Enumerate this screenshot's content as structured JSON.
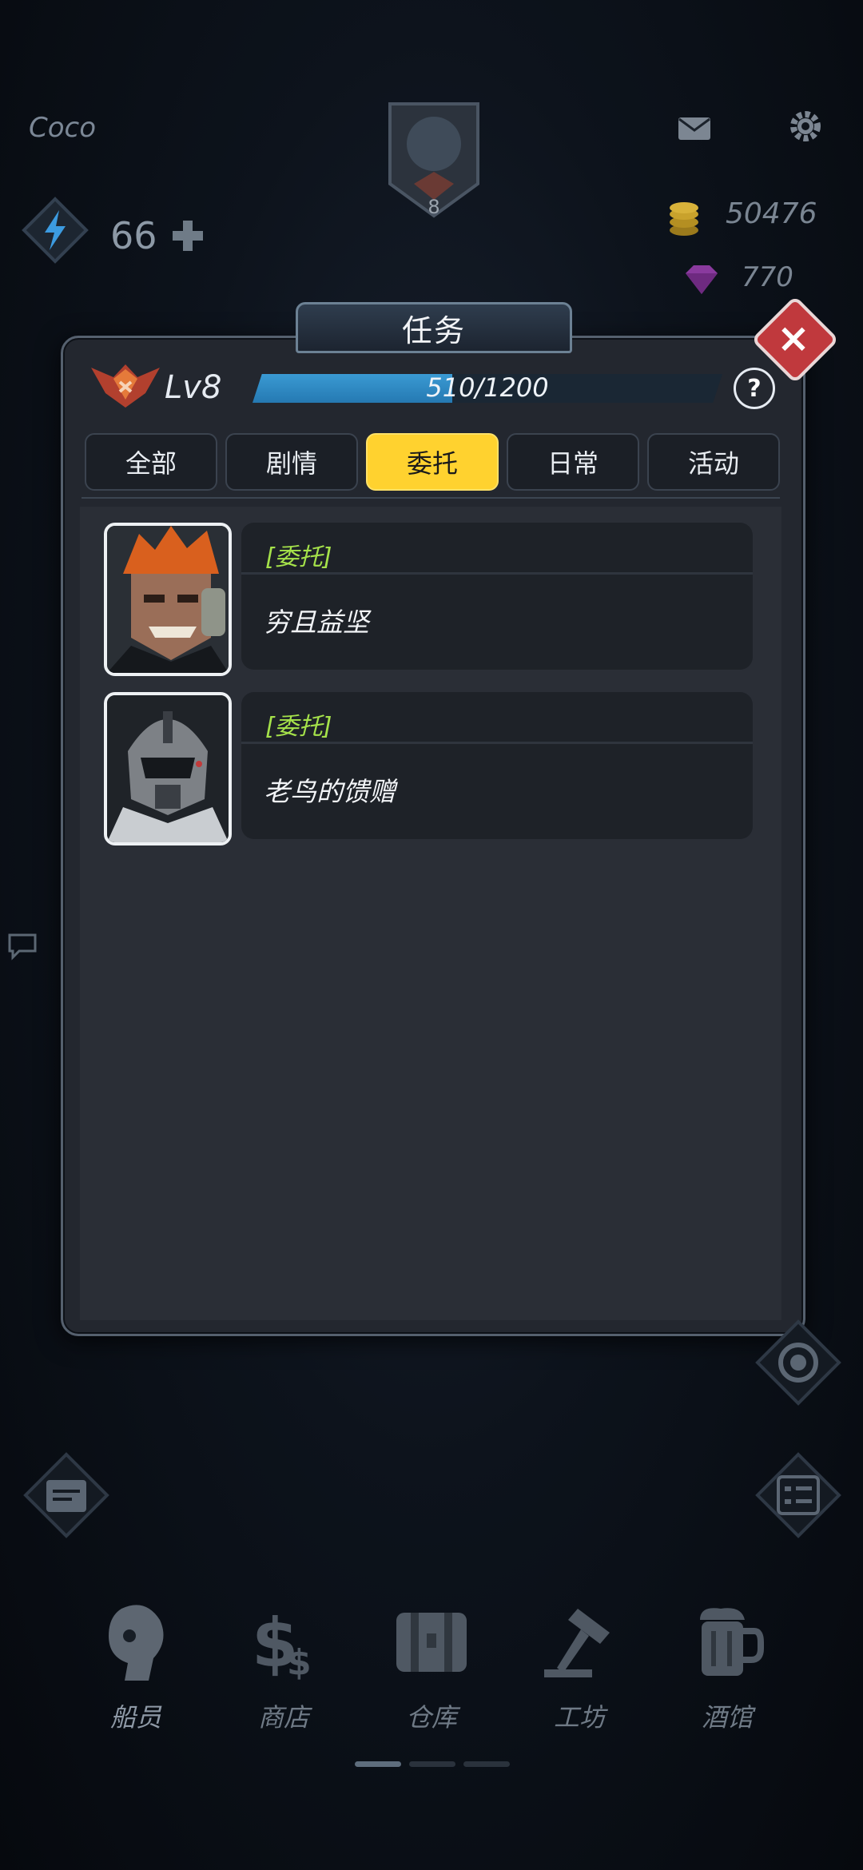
{
  "hud": {
    "player_name": "Coco",
    "rank_level": "8",
    "energy": "66",
    "coins": "50476",
    "gems": "770"
  },
  "dialog": {
    "title": "任务",
    "level": "Lv8",
    "xp_text": "510/1200",
    "xp_current": 510,
    "xp_max": 1200,
    "help": "?",
    "close": "×"
  },
  "tabs": [
    "全部",
    "剧情",
    "委托",
    "日常",
    "活动"
  ],
  "active_tab": 2,
  "quests": [
    {
      "tag": "[委托]",
      "name": "穷且益坚",
      "portrait": "orange-hair-mercenary"
    },
    {
      "tag": "[委托]",
      "name": "老鸟的馈赠",
      "portrait": "helmeted-soldier"
    }
  ],
  "nav": [
    {
      "label": "船员",
      "icon": "crew-icon"
    },
    {
      "label": "商店",
      "icon": "shop-icon"
    },
    {
      "label": "仓库",
      "icon": "warehouse-icon"
    },
    {
      "label": "工坊",
      "icon": "workshop-icon"
    },
    {
      "label": "酒馆",
      "icon": "tavern-icon"
    }
  ],
  "colors": {
    "accent": "#ffd22f",
    "quest_tag": "#a5e24a",
    "xp_fill": "#3a9ad3",
    "close": "#c0393d"
  }
}
